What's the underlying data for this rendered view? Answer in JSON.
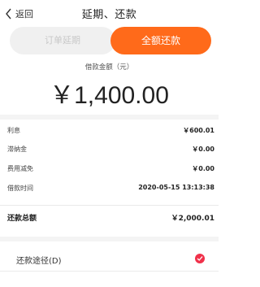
{
  "header": {
    "back_label": "返回",
    "title": "延期、还款"
  },
  "segments": {
    "left_label": "订单延期",
    "right_label": "全额还款"
  },
  "amount": {
    "caption": "借款金额（元）",
    "value": "￥1,400.00"
  },
  "details": [
    {
      "label": "利息",
      "value": "￥600.01"
    },
    {
      "label": "滞纳金",
      "value": "￥0.00"
    },
    {
      "label": "费用减免",
      "value": "￥0.00"
    },
    {
      "label": "借款时间",
      "value": "2020-05-15 13:13:38"
    }
  ],
  "total": {
    "label": "还款总额",
    "value": "￥2,000.01"
  },
  "payment": {
    "label": "还款途径(D)",
    "selected": true
  },
  "colors": {
    "accent": "#ff6a1a",
    "check": "#f0314a"
  }
}
